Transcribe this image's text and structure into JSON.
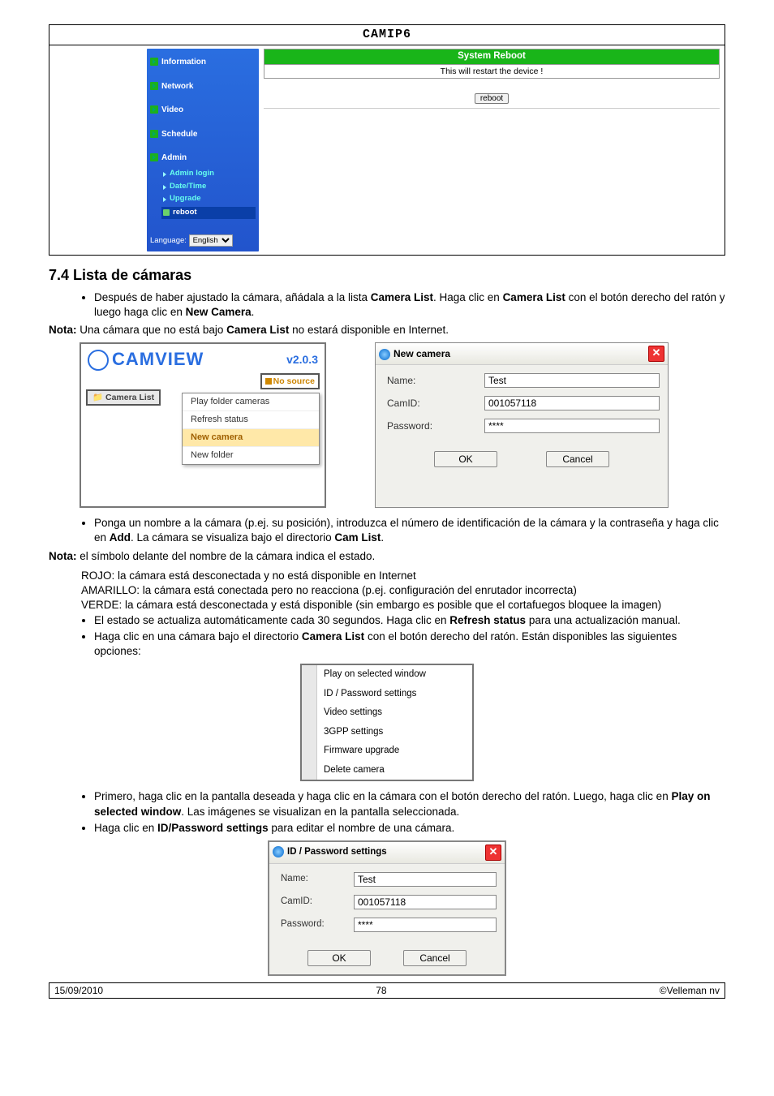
{
  "doc_title": "CAMIP6",
  "admin_ui": {
    "sidebar": {
      "items": [
        "Information",
        "Network",
        "Video",
        "Schedule",
        "Admin"
      ],
      "sub": [
        "Admin login",
        "Date/Time",
        "Upgrade",
        "reboot"
      ],
      "lang_label": "Language:",
      "lang_value": "English"
    },
    "main": {
      "title": "System Reboot",
      "subtitle": "This will restart the device !",
      "button": "reboot"
    }
  },
  "section_title": "7.4 Lista de cámaras",
  "para1_a": "Después de haber ajustado la cámara, añádala a la lista ",
  "para1_b": "Camera List",
  "para1_c": ". Haga clic en ",
  "para1_d": "Camera List",
  "para1_e": " con el botón derecho del ratón y luego haga clic en ",
  "para1_f": "New Camera",
  "para1_g": ".",
  "nota1_label": "Nota:",
  "nota1_text": " Una cámara que no está bajo ",
  "nota1_bold": "Camera List",
  "nota1_text2": " no estará disponible en Internet.",
  "camview": {
    "brand": "CAMVIEW",
    "version": "v2.0.3",
    "tab": "Camera List",
    "nosource": "No source",
    "menu": [
      "Play folder cameras",
      "Refresh status",
      "New camera",
      "New folder"
    ]
  },
  "new_cam_dlg": {
    "title": "New camera",
    "name_label": "Name:",
    "name_value": "Test",
    "camid_label": "CamID:",
    "camid_value": "001057118",
    "pwd_label": "Password:",
    "pwd_value": "****",
    "ok": "OK",
    "cancel": "Cancel"
  },
  "para2_a": "Ponga un nombre a la cámara (p.ej. su posición), introduzca el número de identificación de la cámara y la contraseña y haga clic en ",
  "para2_b": "Add",
  "para2_c": ". La cámara se visualiza bajo el directorio ",
  "para2_d": "Cam List",
  "para2_e": ".",
  "nota2_label": "Nota:",
  "nota2_text": " el símbolo delante del nombre de la cámara indica el estado.",
  "states": {
    "r": "ROJO: la cámara está desconectada y no está disponible en Internet",
    "a": "AMARILLO: la cámara está conectada pero no reacciona (p.ej. configuración del enrutador incorrecta)",
    "v": "VERDE: la cámara está desconectada y está disponible (sin embargo es posible que el cortafuegos bloquee la imagen)"
  },
  "para3_a": "El estado se actualiza automáticamente cada 30 segundos. Haga clic en ",
  "para3_b": "Refresh status",
  "para3_c": " para una actualización manual.",
  "para4_a": "Haga clic en una cámara bajo el directorio ",
  "para4_b": "Camera List",
  "para4_c": " con el botón derecho del ratón. Están disponibles las siguientes opciones:",
  "ctx_menu2": [
    "Play on selected window",
    "ID / Password settings",
    "Video settings",
    "3GPP settings",
    "Firmware upgrade",
    "Delete camera"
  ],
  "para5_a": "Primero, haga clic en la pantalla deseada y haga clic en la cámara con el botón derecho del ratón. Luego, haga clic en ",
  "para5_b": "Play on selected window",
  "para5_c": ". Las imágenes se visualizan en la pantalla seleccionada.",
  "para6_a": "Haga clic en ",
  "para6_b": "ID/Password settings",
  "para6_c": " para editar el nombre de una cámara.",
  "idpw_dlg": {
    "title": "ID / Password settings",
    "name_label": "Name:",
    "name_value": "Test",
    "camid_label": "CamID:",
    "camid_value": "001057118",
    "pwd_label": "Password:",
    "pwd_value": "****",
    "ok": "OK",
    "cancel": "Cancel"
  },
  "footer": {
    "date": "15/09/2010",
    "page": "78",
    "copy": "©Velleman nv"
  }
}
